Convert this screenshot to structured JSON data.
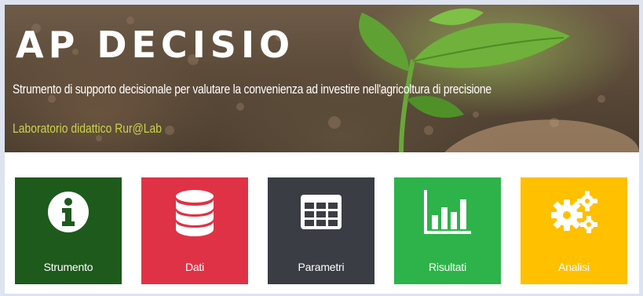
{
  "header": {
    "logo_text": "AP DECISIO",
    "subtitle": "Strumento di supporto decisionale per valutare la convenienza ad investire nell'agricoltura di precisione",
    "lab_text": "Laboratorio didattico Rur@Lab"
  },
  "tiles": [
    {
      "label": "Strumento",
      "icon": "info-icon",
      "color": "#1e5a1c"
    },
    {
      "label": "Dati",
      "icon": "database-icon",
      "color": "#e03246"
    },
    {
      "label": "Parametri",
      "icon": "table-icon",
      "color": "#3a3d44"
    },
    {
      "label": "Risultati",
      "icon": "bar-chart-icon",
      "color": "#2db34a"
    },
    {
      "label": "Analisi",
      "icon": "gears-icon",
      "color": "#ffc000"
    }
  ]
}
